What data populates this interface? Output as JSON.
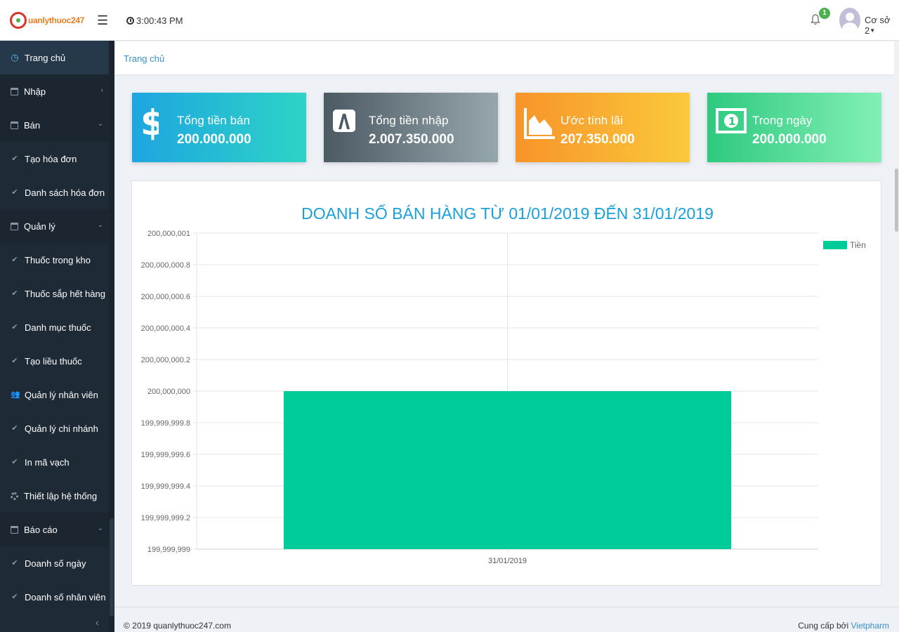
{
  "header": {
    "logo_text": "uanlythuoc247",
    "time": "3:00:43 PM",
    "notification_count": "1",
    "branch": "Cơ sở 2"
  },
  "sidebar": {
    "items": [
      {
        "label": "Trang chủ",
        "icon": "dashboard-icon"
      },
      {
        "label": "Nhập",
        "icon": "calendar-icon",
        "chevron": "‹"
      },
      {
        "label": "Bán",
        "icon": "calendar-icon",
        "chevron": "⌄"
      },
      {
        "label": "Tạo hóa đơn",
        "icon": "check-icon"
      },
      {
        "label": "Danh sách hóa đơn",
        "icon": "check-icon"
      },
      {
        "label": "Quản lý",
        "icon": "calendar-icon",
        "chevron": "⌄"
      },
      {
        "label": "Thuốc trong kho",
        "icon": "check-icon"
      },
      {
        "label": "Thuốc sắp hết hàng",
        "icon": "check-icon"
      },
      {
        "label": "Danh mục thuốc",
        "icon": "check-icon"
      },
      {
        "label": "Tạo liều thuốc",
        "icon": "check-icon"
      },
      {
        "label": "Quản lý nhân viên",
        "icon": "users-icon"
      },
      {
        "label": "Quản lý chi nhánh",
        "icon": "check-icon"
      },
      {
        "label": "In mã vạch",
        "icon": "check-icon"
      },
      {
        "label": "Thiết lập hệ thống",
        "icon": "gear-icon"
      },
      {
        "label": "Báo cáo",
        "icon": "calendar-icon",
        "chevron": "⌄"
      },
      {
        "label": "Doanh số ngày",
        "icon": "check-icon"
      },
      {
        "label": "Doanh số nhân viên",
        "icon": "check-icon"
      }
    ],
    "collapse_glyph": "‹"
  },
  "breadcrumb": {
    "current": "Trang chủ"
  },
  "cards": [
    {
      "title": "Tổng tiền bán",
      "value": "200.000.000",
      "icon": "dollar-icon",
      "colors": [
        "#1ea5e0",
        "#2dd4c6"
      ]
    },
    {
      "title": "Tổng tiền nhập",
      "value": "2.007.350.000",
      "icon": "font-a-icon",
      "colors": [
        "#4c5a63",
        "#96a7ac"
      ]
    },
    {
      "title": "Ước tính lãi",
      "value": "207.350.000",
      "icon": "area-chart-icon",
      "colors": [
        "#f7942a",
        "#fbc93a"
      ]
    },
    {
      "title": "Trong ngày",
      "value": "200.000.000",
      "icon": "money-icon",
      "colors": [
        "#2ec97f",
        "#82f0b4"
      ]
    }
  ],
  "chart_data": {
    "type": "bar",
    "title": "DOANH SỐ BÁN HÀNG TỪ 01/01/2019 ĐẾN 31/01/2019",
    "categories": [
      "31/01/2019"
    ],
    "series": [
      {
        "name": "Tiền",
        "values": [
          200000000
        ],
        "color": "#00cc99"
      }
    ],
    "yticks": [
      "200,000,001",
      "200,000,000.8",
      "200,000,000.6",
      "200,000,000.4",
      "200,000,000.2",
      "200,000,000",
      "199,999,999.8",
      "199,999,999.6",
      "199,999,999.4",
      "199,999,999.2",
      "199,999,999"
    ],
    "ylim": [
      199999999,
      200000001
    ],
    "grid": true,
    "legend": "top-right",
    "title_color": "#1a9fd8"
  },
  "footer": {
    "copyright": "© 2019 quanlythuoc247.com",
    "provider_prefix": "Cung cấp bởi ",
    "provider_link": "Vietpharm"
  }
}
